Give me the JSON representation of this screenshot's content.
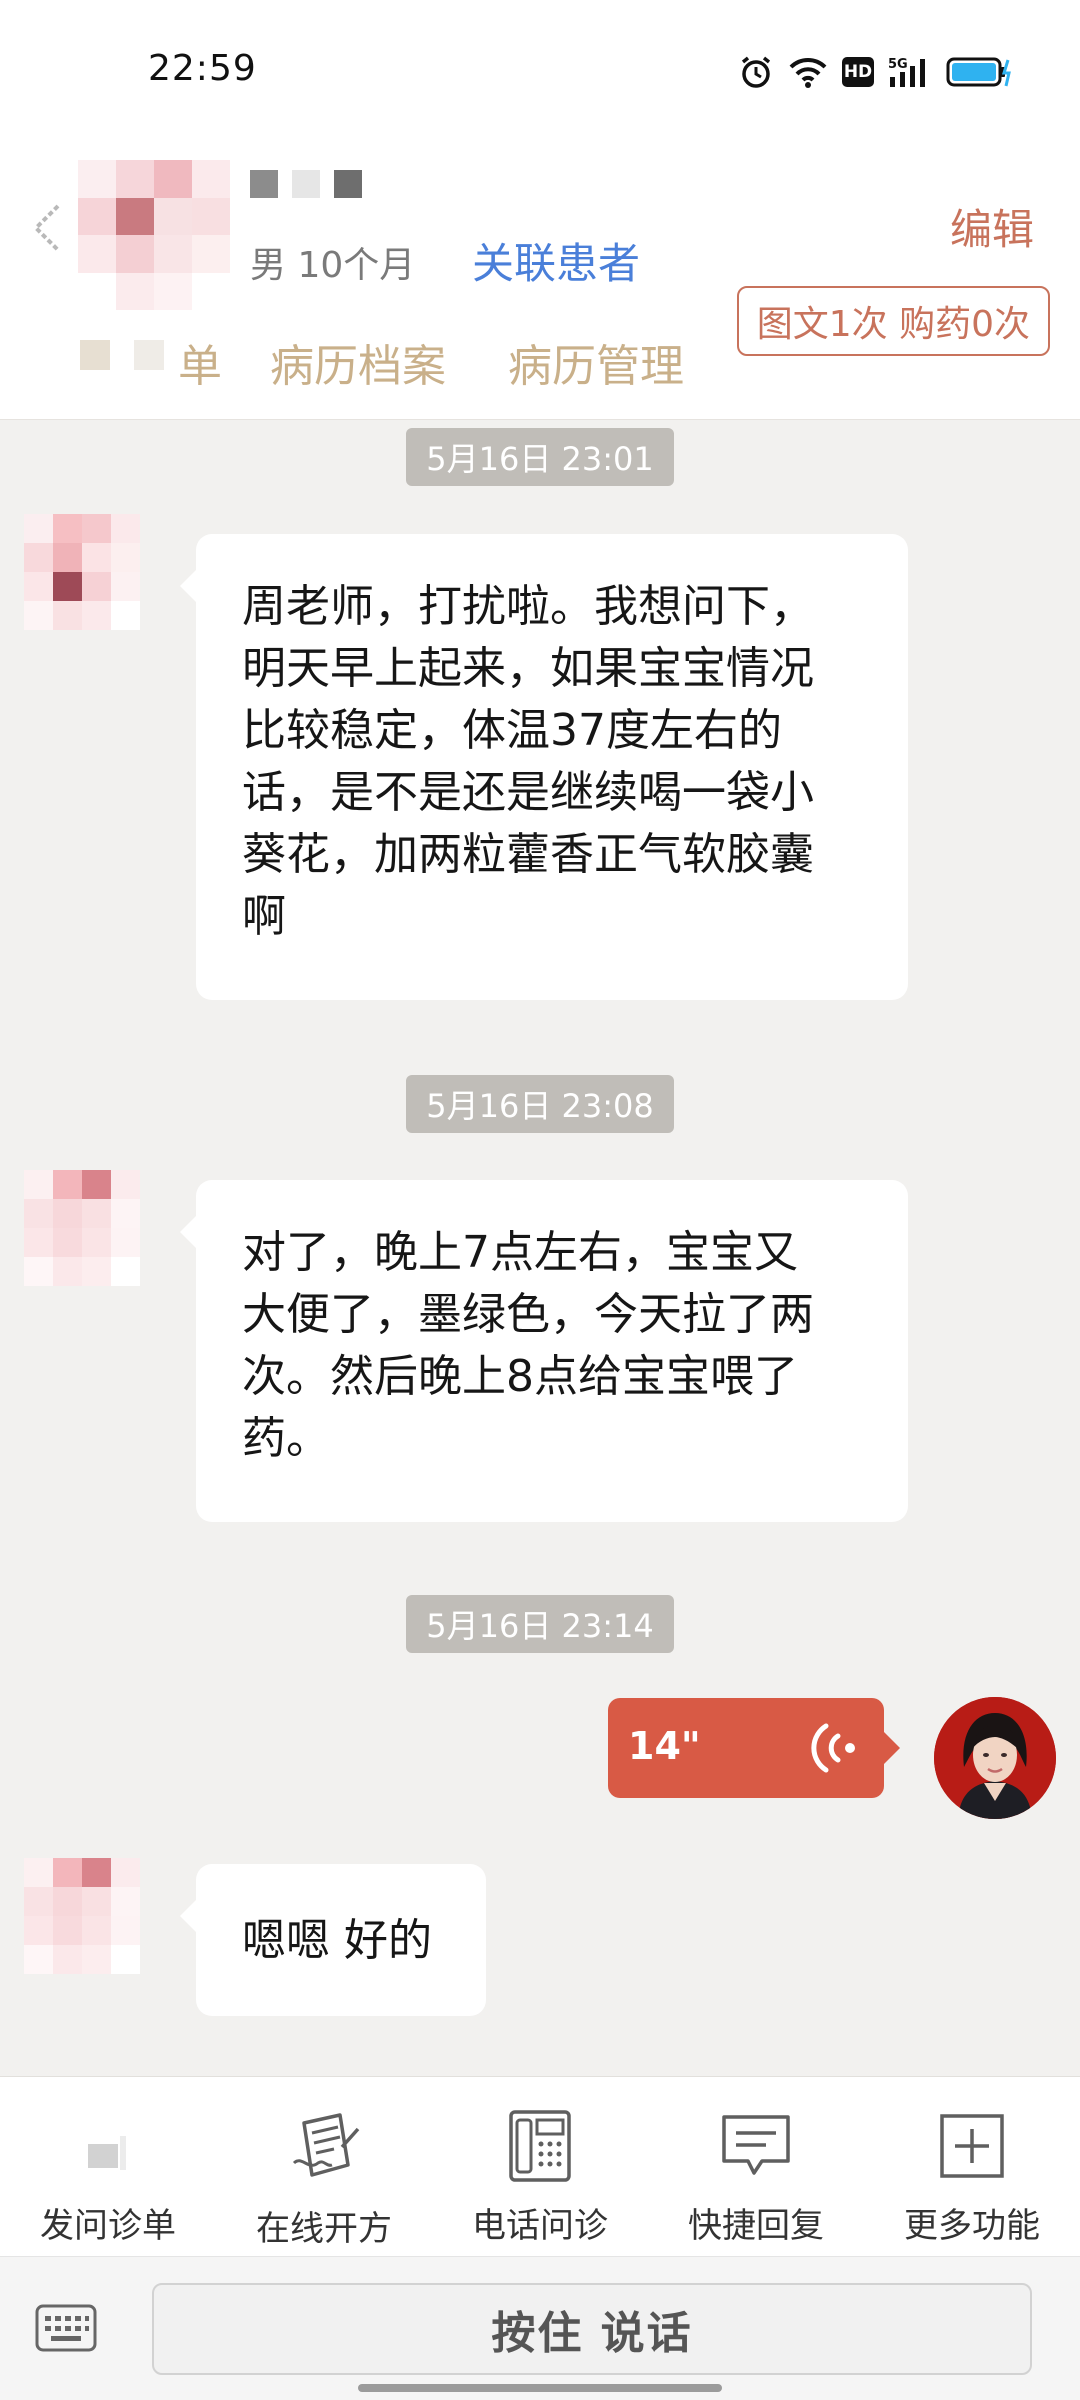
{
  "status_bar": {
    "time": "22:59",
    "hd_label": "HD",
    "network_label": "5G"
  },
  "header": {
    "patient_info": "男 10个月",
    "link_patient": "关联患者",
    "edit": "编辑",
    "tabs": {
      "first_partial": "单",
      "records": "病历档案",
      "record_manage": "病历管理"
    },
    "counts": "图文1次 购药0次"
  },
  "chat": {
    "messages": [
      {
        "time": "5月16日 23:01",
        "lines": [
          "周老师，打扰啦。我想问下，",
          "明天早上起来，如果宝宝情况",
          "比较稳定，体温37度左右的",
          "话，是不是还是继续喝一袋小",
          "葵花，加两粒藿香正气软胶囊",
          "啊"
        ]
      },
      {
        "time": "5月16日 23:08",
        "lines": [
          "对了，晚上7点左右，宝宝又",
          "大便了，墨绿色，今天拉了两",
          "次。然后晚上8点给宝宝喂了",
          "药。"
        ]
      },
      {
        "time": "5月16日 23:14",
        "voice_duration": "14\""
      },
      {
        "text": "嗯嗯 好的"
      }
    ]
  },
  "toolbar": {
    "items": [
      {
        "label": "发问诊单",
        "icon": "questionnaire-icon"
      },
      {
        "label": "在线开方",
        "icon": "prescription-icon"
      },
      {
        "label": "电话问诊",
        "icon": "phone-consult-icon"
      },
      {
        "label": "快捷回复",
        "icon": "quick-reply-icon"
      },
      {
        "label": "更多功能",
        "icon": "more-functions-icon"
      }
    ]
  },
  "input_bar": {
    "hold_to_talk": "按住 说话"
  },
  "colors": {
    "accent": "#c8735c",
    "link": "#4a7fd9",
    "tab_text": "#c9b08a",
    "voice_bubble": "#d85a45",
    "chat_background": "#f2f1ef",
    "time_chip": "#c0bdb8"
  }
}
